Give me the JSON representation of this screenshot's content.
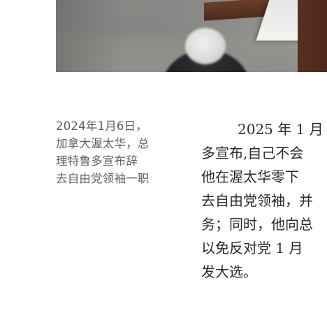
{
  "caption": {
    "lines": [
      "2024年1月6日，",
      "加拿大渥太华，总",
      "理特鲁多宣布辞",
      "去自由党领袖一职"
    ]
  },
  "article": {
    "lines": [
      "2025 年 1 月",
      "多宣布,自己不会",
      "他在渥太华零下",
      "去自由党领袖，并",
      "务；同时，他向总",
      "以免反对党 1 月",
      "发大选。"
    ]
  }
}
